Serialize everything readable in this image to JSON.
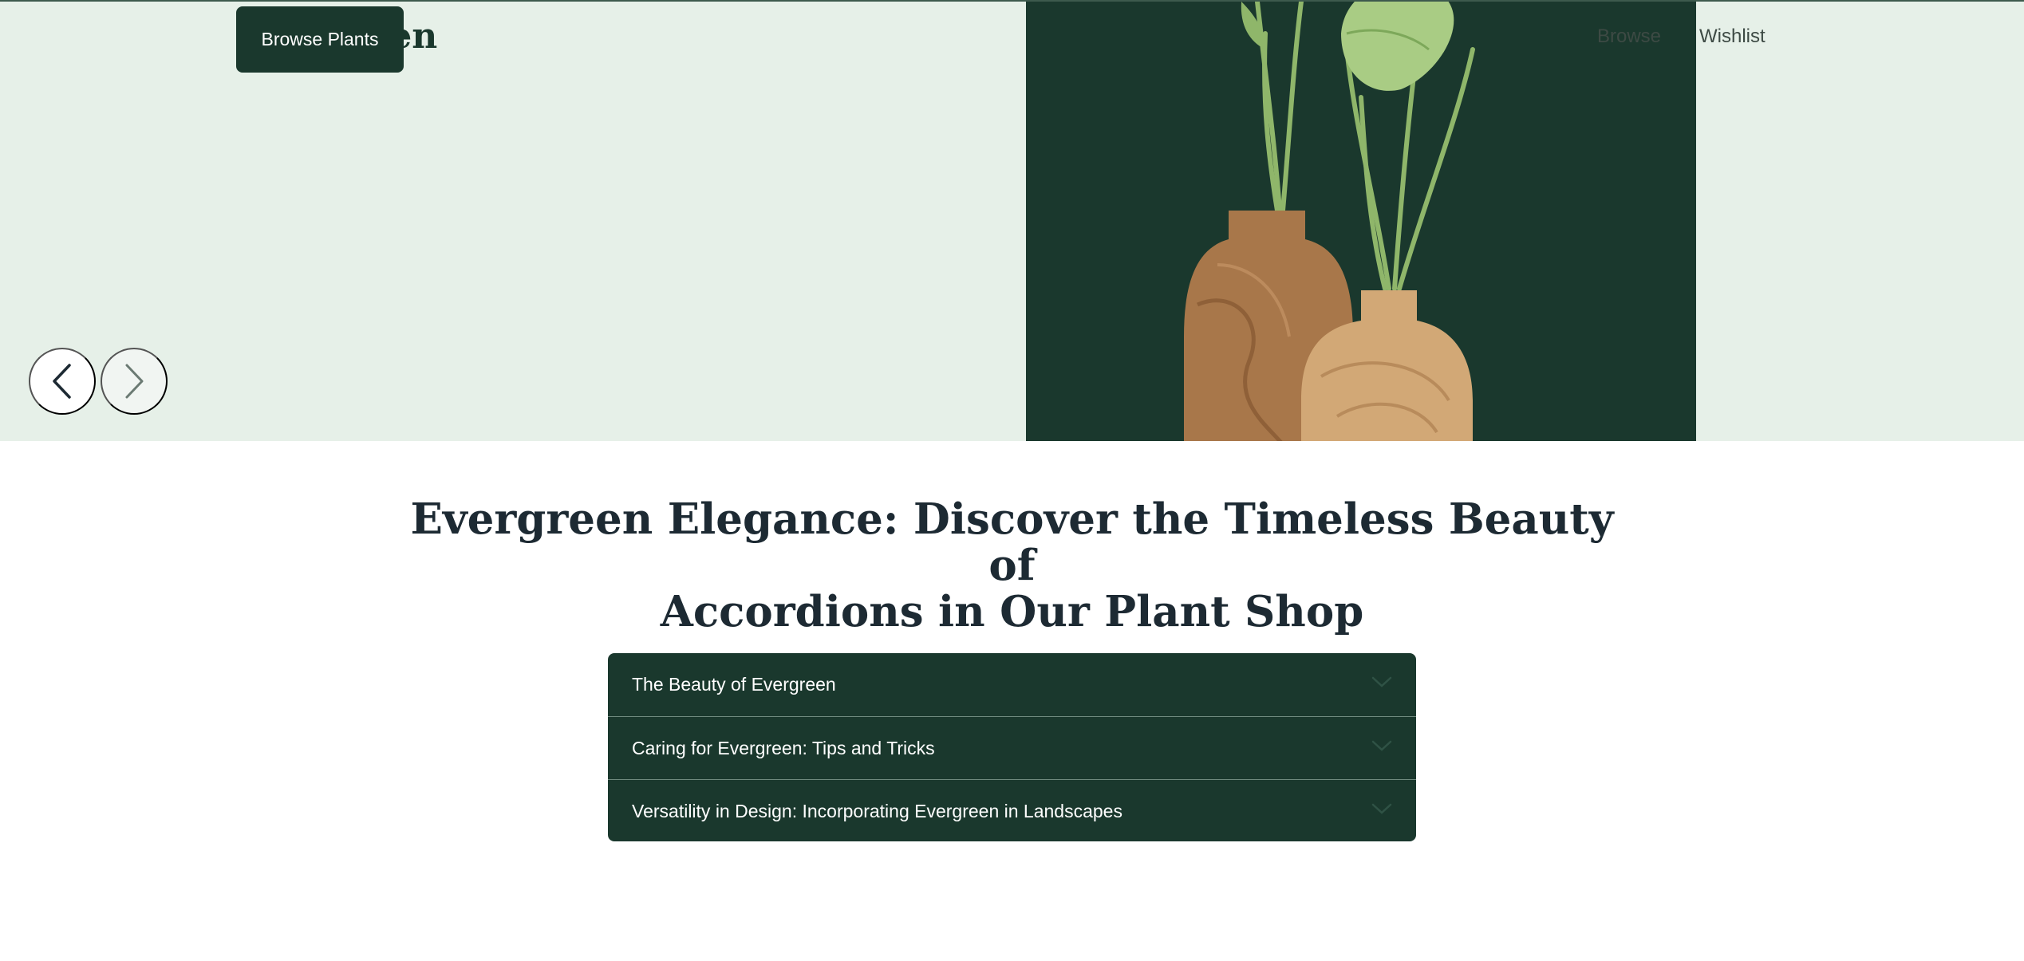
{
  "header": {
    "brand": "Evergreen",
    "cta_label": "Browse Plants",
    "nav": [
      "Browse",
      "Wishlist"
    ]
  },
  "hero": {
    "photo_colors": {
      "background": "#1a382d",
      "vase": "#a8774a",
      "leaf": "#7da85a"
    },
    "carousel": {
      "prev_icon": "chevron-left-icon",
      "next_icon": "chevron-right-icon"
    }
  },
  "main": {
    "headline_line1": "Evergreen Elegance: Discover the Timeless Beauty of",
    "headline_line2": "Accordions in Our Plant Shop",
    "accordion": [
      {
        "title": "The Beauty of Evergreen",
        "icon": "chevron-down-icon"
      },
      {
        "title": "Caring for Evergreen: Tips and Tricks",
        "icon": "chevron-down-icon"
      },
      {
        "title": "Versatility in Design: Incorporating Evergreen in Landscapes",
        "icon": "chevron-down-icon"
      }
    ]
  },
  "colors": {
    "accent": "#1a382d",
    "hero_background": "#e6f0e8",
    "text": "#1d2a33"
  }
}
